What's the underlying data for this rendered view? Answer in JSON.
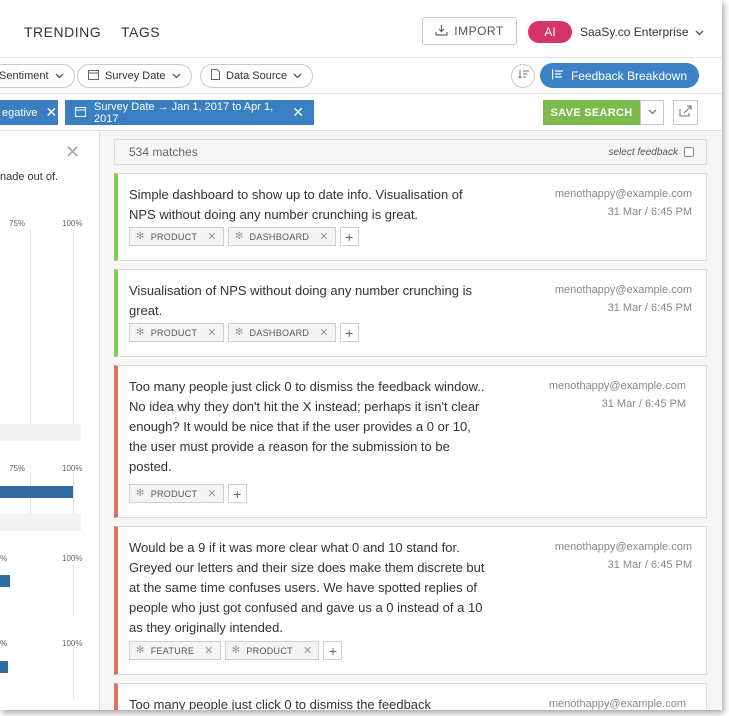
{
  "nav": {
    "trending": "TRENDING",
    "tags": "TAGS",
    "import_label": "IMPORT",
    "ai_label": "AI",
    "org_name": "SaaSy.co Enterprise"
  },
  "filters": {
    "sentiment": "Sentiment",
    "survey_date": "Survey Date",
    "data_source": "Data Source",
    "breakdown_label": "Feedback Breakdown"
  },
  "chips": {
    "negative": "egative",
    "survey_range": "Survey Date → Jan 1, 2017 to Apr 1, 2017",
    "save_search": "SAVE SEARCH"
  },
  "left_panel": {
    "text": "nade out of.",
    "ticks": [
      "75%",
      "100%",
      "75%",
      "100%",
      "%",
      "100%",
      "%",
      "100%"
    ],
    "bar_levels": [
      0.9,
      0.12,
      0.1,
      0.22
    ]
  },
  "results": {
    "matches": "534 matches",
    "select_label": "select feedback"
  },
  "cards": [
    {
      "sentiment": "pos",
      "text": "Simple dashboard to show up to date info. Visualisation of NPS without doing any number crunching is great.",
      "email": "menothappy@example.com",
      "date": "31 Mar / 6:45 PM",
      "tags": [
        "PRODUCT",
        "DASHBOARD"
      ]
    },
    {
      "sentiment": "pos",
      "text": "Visualisation of NPS without doing any number crunching is great.",
      "email": "menothappy@example.com",
      "date": "31 Mar / 6:45 PM",
      "tags": [
        "PRODUCT",
        "DASHBOARD"
      ]
    },
    {
      "sentiment": "neg",
      "text": "Too many people just click 0 to dismiss the feedback window.. No idea why they don't hit the X instead; perhaps it isn't clear enough?  It would be nice that if the user provides a 0 or 10, the user must provide a reason for the submission to be posted.",
      "email": "menothappy@example.com",
      "date": "31 Mar / 6:45 PM",
      "tags": [
        "PRODUCT"
      ]
    },
    {
      "sentiment": "neg",
      "text": "Would be a 9 if it was more clear what 0 and 10 stand for. Greyed our letters and their size does make them discrete but at the same time confuses users. We have spotted replies of people who just got confused and gave us a 0 instead of a 10 as they originally intended.",
      "email": "menothappy@example.com",
      "date": "31 Mar / 6:45 PM",
      "tags": [
        "FEATURE",
        "PRODUCT"
      ]
    },
    {
      "sentiment": "neg",
      "text": "Too many people just click 0 to dismiss the feedback",
      "email": "menothappy@example.com",
      "date": "",
      "tags": []
    }
  ]
}
